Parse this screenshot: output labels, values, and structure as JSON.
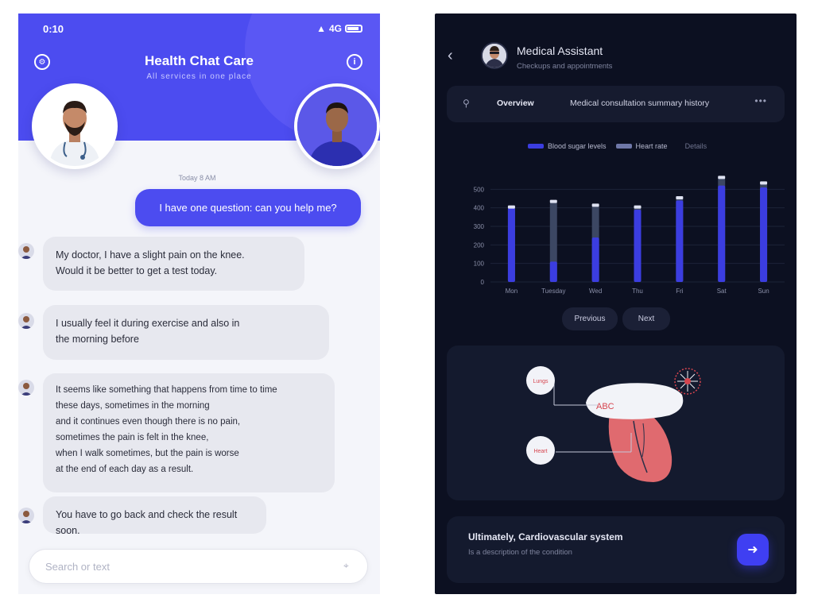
{
  "left": {
    "status": {
      "time": "0:10",
      "network": "4G"
    },
    "header": {
      "title": "Health Chat Care",
      "subtitle": "All services in one place"
    },
    "date_label": "Today 8 AM",
    "outgoing_message": "I have one question: can you help me?",
    "messages": [
      {
        "lines": [
          "My doctor, I have a slight pain on the knee.",
          "Would it be better to get a test today."
        ]
      },
      {
        "lines": [
          "I usually feel it during exercise and also in",
          "the morning before"
        ]
      },
      {
        "lines": [
          "It seems like something that happens from time to time",
          "these days, sometimes in the morning",
          "and it continues even though there is no pain,",
          "sometimes the pain is felt in the knee,",
          "when I walk sometimes, but the pain is worse",
          "at the end of each day as a result."
        ]
      },
      {
        "lines": [
          "You have to go back and check the result soon."
        ]
      }
    ],
    "input": {
      "placeholder": "Search or text"
    }
  },
  "right": {
    "contact": {
      "name": "Medical Assistant",
      "subtitle": "Checkups and appointments"
    },
    "tabs": {
      "active": "Overview",
      "title": "Medical consultation summary history",
      "more": "•••"
    },
    "legend": {
      "series_a": "Blood sugar levels",
      "series_b": "Heart rate",
      "extra": "Details"
    },
    "pills": [
      "Previous",
      "Next"
    ],
    "anatomy": {
      "label_top": "Lungs",
      "label_mid": "Heart",
      "label_center": "ABC"
    },
    "message_card": {
      "title": "Ultimately, Cardiovascular system",
      "subtitle": "Is a description of the condition"
    },
    "colors": {
      "accent": "#4c4cf0",
      "dark_bg": "#0c1021",
      "card_bg": "#141a2e",
      "bar_primary": "#3b3de0",
      "bar_secondary": "#3c4763"
    }
  },
  "chart_data": {
    "type": "bar",
    "title": "",
    "categories": [
      "Mon",
      "Tuesday",
      "Wed",
      "Thu",
      "Fri",
      "Sat",
      "Sun"
    ],
    "series": [
      {
        "name": "Blood sugar levels",
        "values": [
          400,
          110,
          240,
          390,
          440,
          520,
          510
        ]
      },
      {
        "name": "Heart rate",
        "values": [
          400,
          430,
          410,
          400,
          450,
          560,
          530
        ]
      }
    ],
    "yticks": [
      "500",
      "400",
      "300",
      "200",
      "100",
      "0"
    ],
    "ylim": [
      0,
      600
    ],
    "grid": true,
    "legend": "top"
  }
}
